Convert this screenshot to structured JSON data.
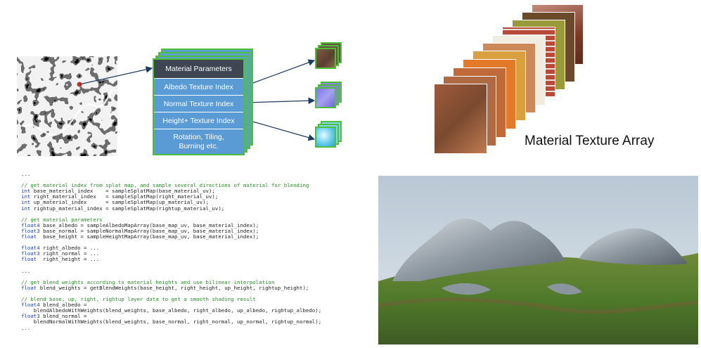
{
  "diagram": {
    "params": {
      "title": "Material Parameters",
      "rows": [
        "Albedo Texture Index",
        "Normal Texture Index",
        "Height+ Texture Index",
        "Rotation, Tiling, Burning etc."
      ]
    },
    "array_label": "Material Texture Array"
  },
  "code_lines": [
    {
      "t": "...",
      "c": "plain"
    },
    {
      "t": "",
      "c": "plain"
    },
    {
      "t": "// get material index from splat map, and sample several directions of material for blending",
      "c": "comment"
    },
    {
      "kw": "int",
      "t": " base_material_index    = sampleSplatMap(base_material_uv);",
      "c": "code"
    },
    {
      "kw": "int",
      "t": " right_material_index   = sampleSplatMap(right_material_uv);",
      "c": "code"
    },
    {
      "kw": "int",
      "t": " up_material_index      = sampleSplatMap(up_material_uv);",
      "c": "code"
    },
    {
      "kw": "int",
      "t": " rightup_material_index = sampleSplatMap(rightup_material_uv);",
      "c": "code"
    },
    {
      "t": "",
      "c": "plain"
    },
    {
      "t": "// get material parameters",
      "c": "comment"
    },
    {
      "kw": "float4",
      "t": " base_albedo = sampleAlbedoMapArray(base_map_uv, base_material_index);",
      "c": "code"
    },
    {
      "kw": "float3",
      "t": " base_normal = sampleNormalMapArray(base_map_uv, base_material_index);",
      "c": "code"
    },
    {
      "kw": "float",
      "t": "  base_height = sampleHeightMapArray(base_map_uv, base_material_index);",
      "c": "code"
    },
    {
      "t": "",
      "c": "plain"
    },
    {
      "kw": "float4",
      "t": " right_albedo = ...",
      "c": "code"
    },
    {
      "kw": "float3",
      "t": " right_normal = ...",
      "c": "code"
    },
    {
      "kw": "float",
      "t": "  right_height = ...",
      "c": "code"
    },
    {
      "t": "",
      "c": "plain"
    },
    {
      "t": "...",
      "c": "plain"
    },
    {
      "t": "",
      "c": "plain"
    },
    {
      "t": "// get blend weights according to material heights and use bilinear interpolation",
      "c": "comment"
    },
    {
      "kw": "float",
      "t": " blend_weights = getBlendWeights(base_height, right_height, up_height, rightup_height);",
      "c": "code"
    },
    {
      "t": "",
      "c": "plain"
    },
    {
      "t": "// blend base, up, right, rightup layer data to get a smooth shading result",
      "c": "comment"
    },
    {
      "kw": "float4",
      "t": " blend_albedo =",
      "c": "code"
    },
    {
      "t": "    blendAlbedoWithWeights(blend_weights, base_albedo, right_albedo, up_albedo, rightup_albedo);",
      "c": "plain"
    },
    {
      "kw": "float3",
      "t": " blend_normal =",
      "c": "code"
    },
    {
      "t": "    blendNormalWithWeights(blend_weights, base_normal, right_normal, up_normal, rightup_normal);",
      "c": "plain"
    },
    {
      "t": "...",
      "c": "plain"
    }
  ],
  "colors": {
    "stack_border": "#4fbf3a",
    "row_blue": "#5b9bd5",
    "header_dark": "#3d4652",
    "comment_green": "#2a8a2a",
    "keyword_blue": "#1a3fb0"
  }
}
